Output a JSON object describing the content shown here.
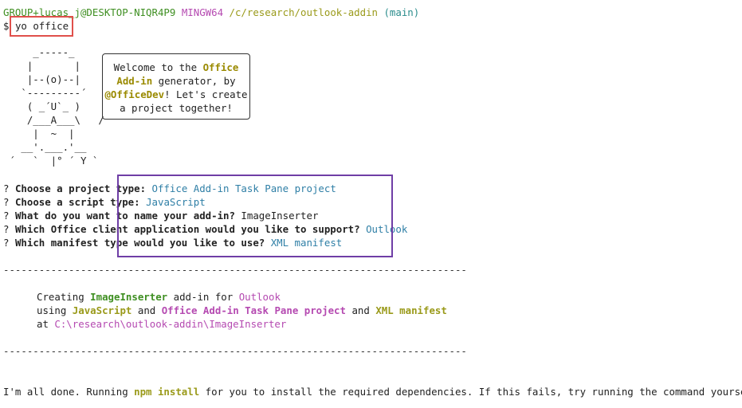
{
  "prompt": {
    "user_host": "GROUP+lucas_j@DESKTOP-NIQR4P9",
    "shell": "MINGW64",
    "path": "/c/research/outlook-addin",
    "branch": "(main)",
    "symbol": "$",
    "command": "yo office"
  },
  "yeoman": {
    "ascii_art": "     _-----_\n    |       |\n    |--(o)--|\n   `---------´\n    ( _´U`_ )\n    /___A___\\   /\n     |  ~  |\n   __'.___.'__\n ´   `  |° ´ Y `",
    "bubble_line1_plain": "Welcome to the ",
    "bubble_line1_hl": "Office",
    "bubble_line2_hl": "Add-in",
    "bubble_line2_plain": " generator, by",
    "bubble_line3_hl": "@OfficeDev",
    "bubble_line3_plain": "! Let's create",
    "bubble_line4": "a project together!"
  },
  "questions": [
    {
      "mark": "?",
      "text": "Choose a project type:",
      "answer": "Office Add-in Task Pane project"
    },
    {
      "mark": "?",
      "text": "Choose a script type:",
      "answer": "JavaScript"
    },
    {
      "mark": "?",
      "text": "What do you want to name your add-in?",
      "answer": "ImageInserter"
    },
    {
      "mark": "?",
      "text": "Which Office client application would you like to support?",
      "answer": "Outlook"
    },
    {
      "mark": "?",
      "text": "Which manifest type would you like to use?",
      "answer": "XML manifest"
    }
  ],
  "separator": "------------------------------------------------------------------------------------------------",
  "summary": {
    "creating": "Creating",
    "name": "ImageInserter",
    "addin_for": "add-in for",
    "host": "Outlook",
    "using": "using",
    "script": "JavaScript",
    "and1": "and",
    "project": "Office Add-in Task Pane project",
    "and2": "and",
    "manifest": "XML manifest",
    "at": "at",
    "path": "C:\\research\\outlook-addin\\ImageInserter"
  },
  "footer": {
    "pre": "I'm all done. Running ",
    "cmd": "npm install",
    "post": " for you to install the required dependencies. If this fails, try running the command yourself."
  },
  "colors": {
    "green": "#3f8f22",
    "purple": "#b54ab1",
    "blue": "#2f7fa6",
    "olive": "#9a9a1a",
    "highlight_red": "#e0504b",
    "highlight_purple": "#6f3ea6"
  }
}
